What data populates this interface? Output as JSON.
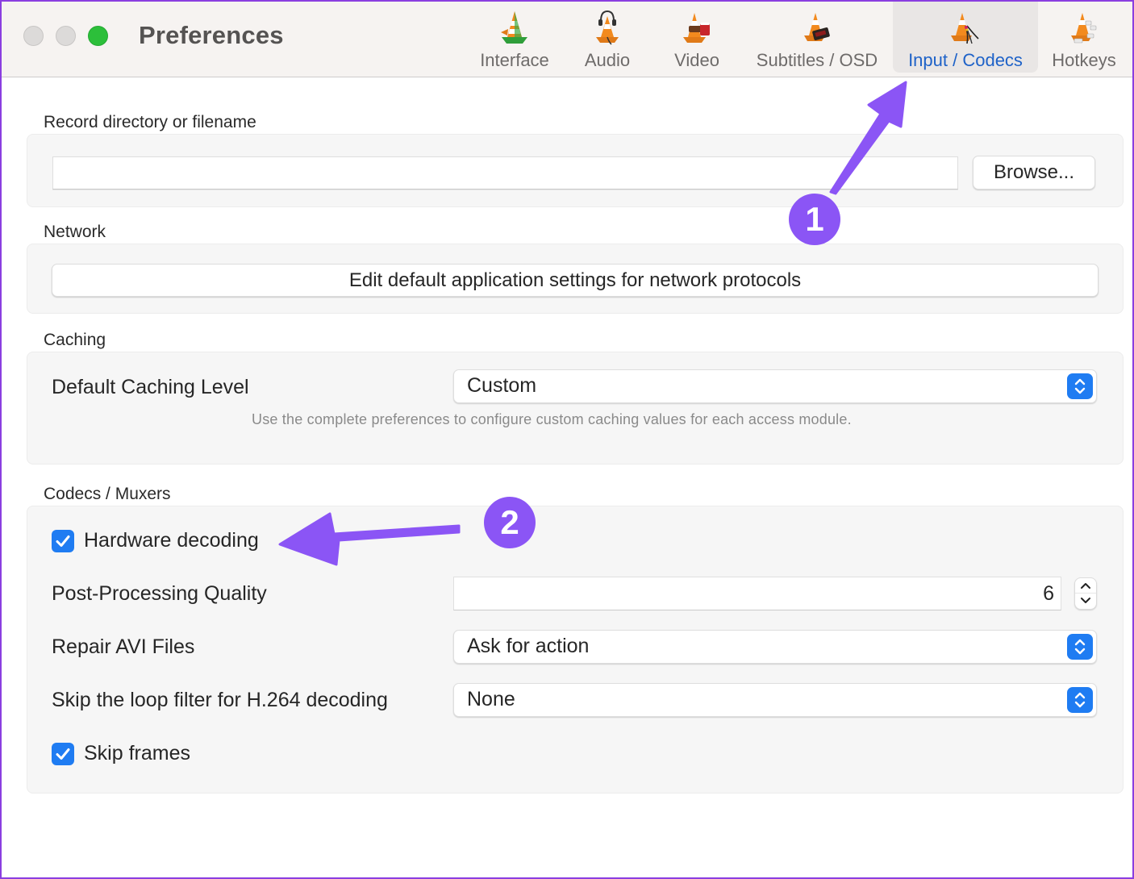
{
  "window": {
    "title": "Preferences",
    "buttons": [
      "close",
      "minimize",
      "zoom"
    ]
  },
  "toolbar": {
    "tabs": [
      {
        "label": "Interface",
        "icon": "vlc-cone-interface-icon",
        "active": false
      },
      {
        "label": "Audio",
        "icon": "vlc-cone-headphones-icon",
        "active": false
      },
      {
        "label": "Video",
        "icon": "vlc-cone-film-icon",
        "active": false
      },
      {
        "label": "Subtitles / OSD",
        "icon": "vlc-cone-clock-icon",
        "active": false
      },
      {
        "label": "Input / Codecs",
        "icon": "vlc-cone-cables-icon",
        "active": true
      },
      {
        "label": "Hotkeys",
        "icon": "vlc-cone-keyboard-icon",
        "active": false
      }
    ]
  },
  "sections": {
    "record": {
      "label": "Record directory or filename",
      "path_value": "",
      "browse_label": "Browse..."
    },
    "network": {
      "label": "Network",
      "button_label": "Edit default application settings for network protocols"
    },
    "caching": {
      "label": "Caching",
      "level_label": "Default Caching Level",
      "level_value": "Custom",
      "hint": "Use the complete preferences to configure custom caching values for each access module."
    },
    "codecs": {
      "label": "Codecs / Muxers",
      "hardware_decoding": {
        "label": "Hardware decoding",
        "checked": true
      },
      "post_processing": {
        "label": "Post-Processing Quality",
        "value": "6"
      },
      "repair_avi": {
        "label": "Repair AVI Files",
        "value": "Ask for action"
      },
      "skip_loop_filter": {
        "label": "Skip the loop filter for H.264 decoding",
        "value": "None"
      },
      "skip_frames": {
        "label": "Skip frames",
        "checked": true
      }
    }
  },
  "annotations": {
    "badge_1": "1",
    "badge_2": "2",
    "color": "#8b55f5"
  },
  "colors": {
    "accent": "#1f7cf2",
    "active_tab_text": "#1e62c8",
    "window_border": "#8a3ee0",
    "traffic_green": "#2cbf3a"
  }
}
